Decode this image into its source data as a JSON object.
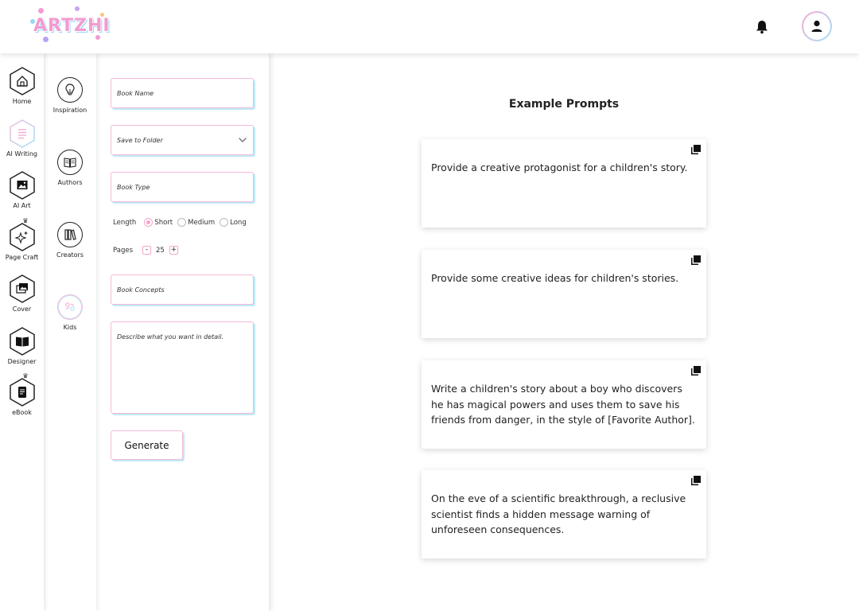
{
  "header": {
    "logo_text": "ARTZHI",
    "icons": {
      "bell": "bell-icon",
      "profile": "user-icon"
    }
  },
  "rail": {
    "items": [
      {
        "label": "Home",
        "icon": "home-icon",
        "premium": false
      },
      {
        "label": "AI Writing",
        "icon": "document-lines-icon",
        "premium": false,
        "active": true
      },
      {
        "label": "AI Art",
        "icon": "image-icon",
        "premium": false
      },
      {
        "label": "Page Craft",
        "icon": "sparkles-icon",
        "premium": true
      },
      {
        "label": "Cover",
        "icon": "photo-stack-icon",
        "premium": false
      },
      {
        "label": "Designer",
        "icon": "open-book-icon",
        "premium": false
      },
      {
        "label": "eBook",
        "icon": "ebook-icon",
        "premium": true
      }
    ]
  },
  "rail2": {
    "items": [
      {
        "label": "Inspiration",
        "icon": "lightbulb-icon"
      },
      {
        "label": "Authors",
        "icon": "book-pages-icon"
      },
      {
        "label": "Creators",
        "icon": "books-icon"
      },
      {
        "label": "Kids",
        "icon": "kids-icon"
      }
    ]
  },
  "form": {
    "book_name_placeholder": "Book Name",
    "save_to_folder_placeholder": "Save to Folder",
    "book_type_placeholder": "Book Type",
    "length_label": "Length",
    "length_options": [
      "Short",
      "Medium",
      "Long"
    ],
    "length_selected": "Short",
    "pages_label": "Pages",
    "pages_minus": "-",
    "pages_value": "25",
    "pages_plus": "+",
    "book_concepts_placeholder": "Book Concepts",
    "describe_placeholder": "Describe what you want in detail.",
    "generate_label": "Generate"
  },
  "main": {
    "title": "Example Prompts",
    "prompts": [
      "Provide a creative protagonist for a children's story.",
      "Provide some creative ideas for children's stories.",
      "Write a children's story about a boy who discovers he has magical powers and uses them to save his friends from danger, in the style of [Favorite Author].",
      "On the eve of a scientific breakthrough, a reclusive scientist finds a hidden message warning of unforeseen consequences."
    ]
  },
  "colors": {
    "accent_pink": "#f4b9d8",
    "accent_blue": "#bfe9f7",
    "text": "#222222"
  }
}
